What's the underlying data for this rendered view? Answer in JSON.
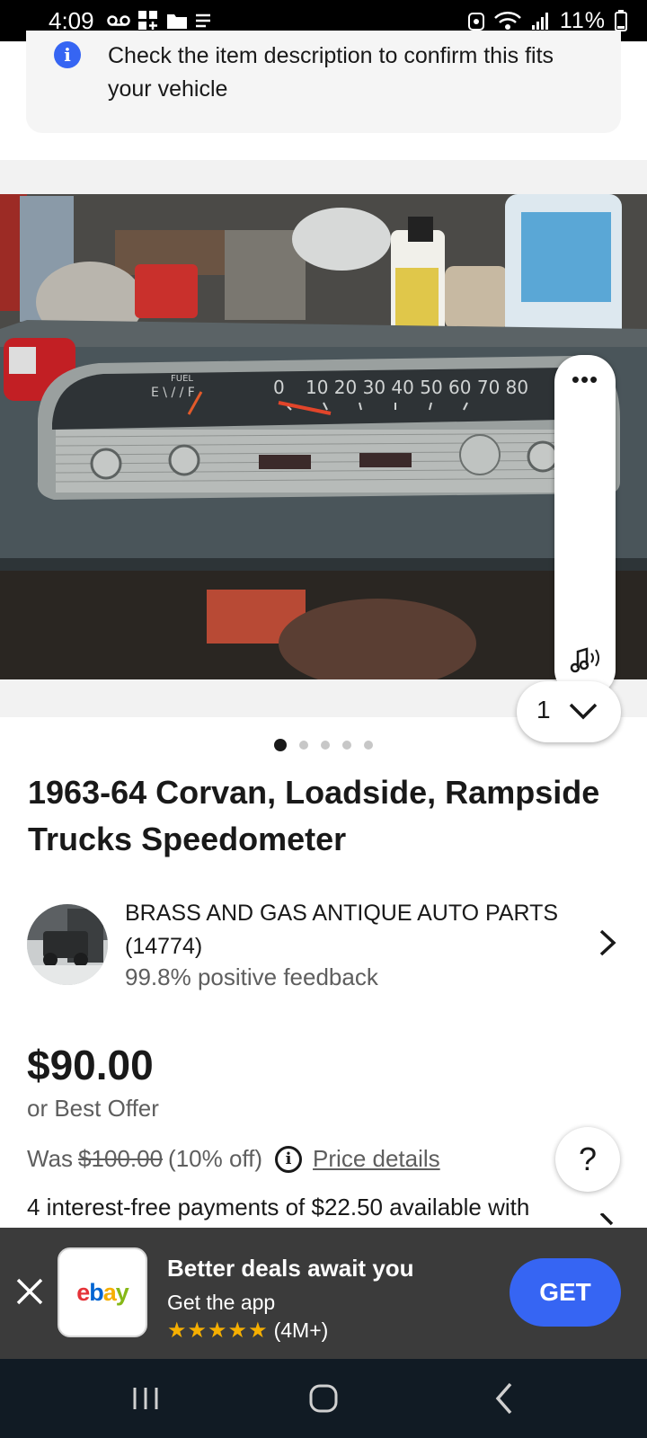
{
  "status_bar": {
    "time": "4:09",
    "battery": "11%"
  },
  "fit_notice": {
    "text": "Check the item description to confirm this fits your vehicle",
    "icon": "info-icon"
  },
  "gallery": {
    "photo_description_icon": "instrument-cluster-photo",
    "image_index": "1",
    "total_dots": 5,
    "active_dot": 0,
    "toolbar_icons": [
      "more-dots-icon",
      "audio-icon"
    ]
  },
  "listing": {
    "title": "1963-64 Corvan, Loadside, Rampside Trucks Speedometer"
  },
  "seller": {
    "name": "BRASS AND GAS ANTIQUE AUTO PARTS",
    "count": "(14774)",
    "feedback": "99.8% positive feedback"
  },
  "pricing": {
    "price": "$90.00",
    "best_offer": "or Best Offer",
    "was_label": "Was",
    "was_price": "$100.00",
    "discount": "(10% off)",
    "price_details": "Price details",
    "installments": "4 interest-free payments of $22.50 available with"
  },
  "help": {
    "label": "?"
  },
  "app_banner": {
    "headline": "Better deals await you",
    "subtext": "Get the app",
    "stars": "★★★★★",
    "rating_count": "(4M+)",
    "get_label": "GET",
    "logo": {
      "e": "e",
      "b": "b",
      "a": "a",
      "y": "y"
    }
  },
  "colors": {
    "accent": "#3665f3",
    "banner_bg": "#3b3b3b",
    "nav_bg": "#111b24"
  }
}
